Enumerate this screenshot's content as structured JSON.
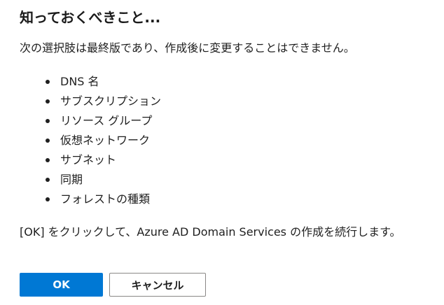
{
  "dialog": {
    "title": "知っておくべきこと...",
    "intro": "次の選択肢は最終版であり、作成後に変更することはできません。",
    "items": [
      "DNS 名",
      "サブスクリプション",
      "リソース グループ",
      "仮想ネットワーク",
      "サブネット",
      "同期",
      "フォレストの種類"
    ],
    "outro": "[OK] をクリックして、Azure AD Domain Services の作成を続行します。",
    "ok_label": "OK",
    "cancel_label": "キャンセル"
  },
  "colors": {
    "primary": "#0078d4",
    "text": "#1f1f1f",
    "cancel_border": "#8a8886"
  }
}
